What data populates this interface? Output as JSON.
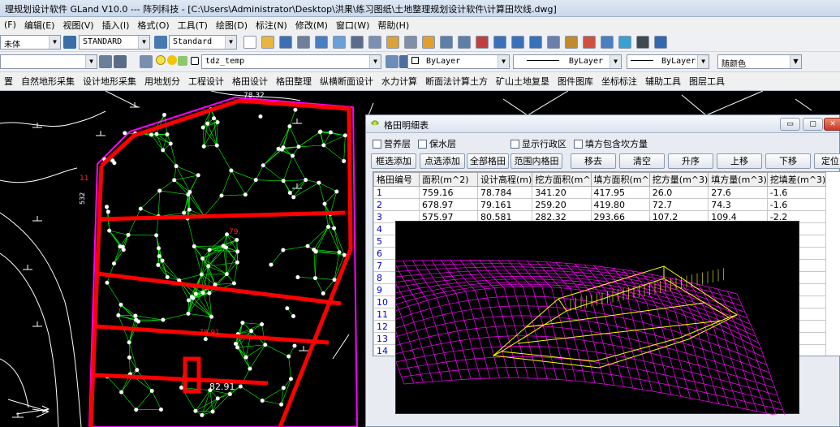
{
  "window": {
    "title": "理规划设计软件 GLand V10.0 --- 阵列科技 - [C:\\Users\\Administrator\\Desktop\\洪果\\练习图纸\\土地整理规划设计软件\\计算田坎线.dwg]"
  },
  "menu": [
    "(F)",
    "编辑(E)",
    "视图(V)",
    "插入(I)",
    "格式(O)",
    "工具(T)",
    "绘图(D)",
    "标注(N)",
    "修改(M)",
    "窗口(W)",
    "帮助(H)"
  ],
  "toolbar1": {
    "font_combo": "未体",
    "textstyle_combo": "STANDARD",
    "dimstyle_combo": "Standard"
  },
  "toolbar2": {
    "layer_combo": "tdz_temp",
    "color_combo": "ByLayer",
    "linetype_combo": "ByLayer",
    "lineweight_combo": "ByLayer",
    "plotstyle_combo": "随颜色"
  },
  "plugin_menu": [
    "置",
    "自然地形采集",
    "设计地形采集",
    "用地划分",
    "工程设计",
    "格田设计",
    "格田整理",
    "纵横断面设计",
    "水力计算",
    "断面法计算土方",
    "矿山土地复垦",
    "图件图库",
    "坐标标注",
    "辅助工具",
    "图层工具"
  ],
  "drawing": {
    "labels": {
      "elev_top": "78.32",
      "elev_1": "79.",
      "elev_2": "78.91",
      "elev_3": "82.91",
      "side_num": "11",
      "grid_text": "532"
    }
  },
  "panel": {
    "title": "格田明细表",
    "checkboxes": [
      "营养层",
      "保水层",
      "显示行政区",
      "填方包含坎方量"
    ],
    "buttons": [
      "框选添加",
      "点选添加",
      "全部格田",
      "范围内格田",
      "移去",
      "清空",
      "升序",
      "上移",
      "下移",
      "定位"
    ],
    "columns": [
      "格田编号",
      "面积(m^2)",
      "设计高程(m)",
      "挖方面积(m^",
      "填方面积(m^",
      "挖方量(m^3)",
      "填方量(m^3)",
      "挖填差(m^3)"
    ],
    "rows": [
      [
        "1",
        "759.16",
        "78.784",
        "341.20",
        "417.95",
        "26.0",
        "27.6",
        "-1.6"
      ],
      [
        "2",
        "678.97",
        "79.161",
        "259.20",
        "419.80",
        "72.7",
        "74.3",
        "-1.6"
      ],
      [
        "3",
        "575.97",
        "80.581",
        "282.32",
        "293.66",
        "107.2",
        "109.4",
        "-2.2"
      ],
      [
        "4",
        "",
        "",
        "",
        "",
        "",
        "",
        ""
      ],
      [
        "5",
        "",
        "",
        "",
        "",
        "",
        "",
        ""
      ],
      [
        "6",
        "",
        "",
        "",
        "",
        "",
        "",
        ""
      ],
      [
        "7",
        "",
        "",
        "",
        "",
        "",
        "",
        ""
      ],
      [
        "8",
        "",
        "",
        "",
        "",
        "",
        "",
        ""
      ],
      [
        "9",
        "",
        "",
        "",
        "",
        "",
        "",
        ""
      ],
      [
        "10",
        "",
        "",
        "",
        "",
        "",
        "",
        ""
      ],
      [
        "11",
        "",
        "",
        "",
        "",
        "",
        "",
        ""
      ],
      [
        "12",
        "",
        "",
        "",
        "",
        "",
        "",
        ""
      ],
      [
        "13",
        "",
        "",
        "",
        "",
        "",
        "",
        ""
      ],
      [
        "14",
        "",
        "",
        "",
        "",
        "",
        "",
        ""
      ]
    ]
  },
  "colors": {
    "boundary": "#ff0000",
    "mesh": "#ff00ff",
    "cutfill": "#ffff00",
    "tin": "#00ff00",
    "teal": "#008080"
  }
}
